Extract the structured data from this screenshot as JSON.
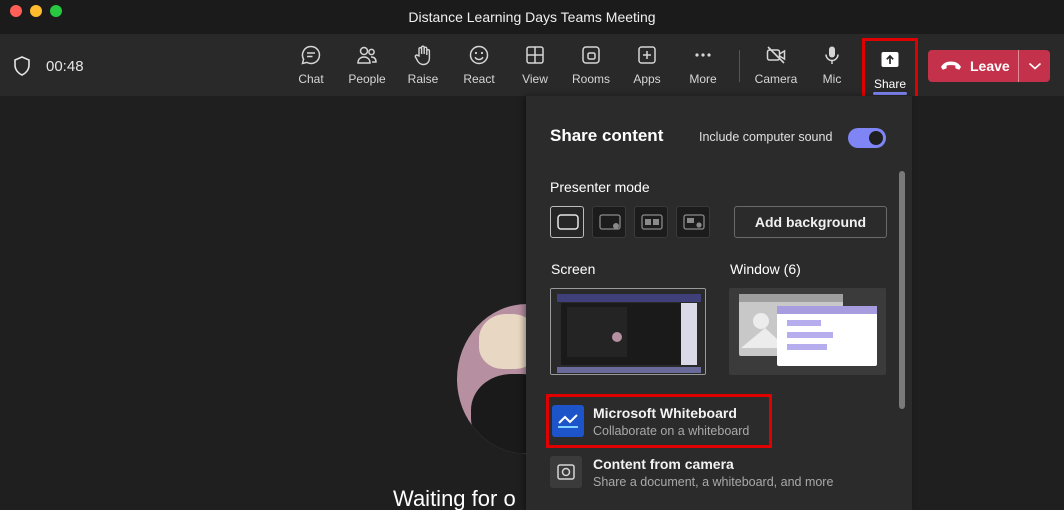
{
  "window": {
    "title": "Distance Learning Days Teams Meeting"
  },
  "toolbar": {
    "timer": "00:48",
    "buttons": [
      {
        "id": "chat",
        "label": "Chat",
        "icon": "chat-icon"
      },
      {
        "id": "people",
        "label": "People",
        "icon": "people-icon"
      },
      {
        "id": "raise",
        "label": "Raise",
        "icon": "hand-icon"
      },
      {
        "id": "react",
        "label": "React",
        "icon": "smiley-icon"
      },
      {
        "id": "view",
        "label": "View",
        "icon": "grid-icon"
      },
      {
        "id": "rooms",
        "label": "Rooms",
        "icon": "rooms-icon"
      },
      {
        "id": "apps",
        "label": "Apps",
        "icon": "plus-square-icon"
      },
      {
        "id": "more",
        "label": "More",
        "icon": "ellipsis-icon"
      },
      {
        "id": "camera",
        "label": "Camera",
        "icon": "camera-off-icon"
      },
      {
        "id": "mic",
        "label": "Mic",
        "icon": "mic-icon"
      }
    ],
    "share_label": "Share",
    "leave_label": "Leave"
  },
  "colors": {
    "accent": "#7f85f5",
    "leave": "#c4314b",
    "highlight": "#e00000",
    "whiteboard": "#1e54c9"
  },
  "share_panel": {
    "title": "Share content",
    "sound_label": "Include computer sound",
    "sound_on": true,
    "presenter_label": "Presenter mode",
    "add_background": "Add background",
    "screen_label": "Screen",
    "window_label": "Window (6)",
    "whiteboard": {
      "title": "Microsoft Whiteboard",
      "subtitle": "Collaborate on a whiteboard"
    },
    "camera_content": {
      "title": "Content from camera",
      "subtitle": "Share a document, a whiteboard, and more"
    }
  },
  "stage": {
    "waiting_text": "Waiting for o"
  }
}
